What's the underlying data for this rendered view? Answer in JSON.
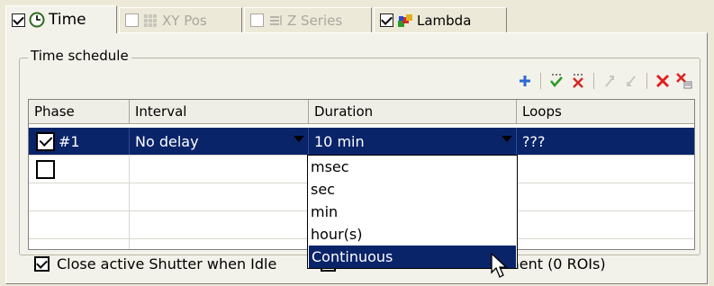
{
  "tabs": [
    {
      "label": "Time",
      "checked": true,
      "active": true,
      "icon": "clock-icon"
    },
    {
      "label": "XY Pos",
      "checked": false,
      "disabled": true,
      "icon": "grid-icon"
    },
    {
      "label": "Z Series",
      "checked": false,
      "disabled": true,
      "icon": "z-stack-icon"
    },
    {
      "label": "Lambda",
      "checked": true,
      "icon": "lambda-colors-icon"
    }
  ],
  "group_title": "Time schedule",
  "toolbar": [
    "add-icon",
    "check-all-icon",
    "uncheck-all-icon",
    "move-up-icon",
    "move-down-icon",
    "delete-icon",
    "delete-all-icon"
  ],
  "grid": {
    "columns": [
      "Phase",
      "Interval",
      "Duration",
      "Loops"
    ],
    "rows": [
      {
        "checked": true,
        "phase": "#1",
        "interval": "No delay",
        "duration": "10 min",
        "loops": "???"
      },
      {
        "checked": false,
        "phase": "",
        "interval": "",
        "duration": "",
        "loops": ""
      }
    ]
  },
  "duration_dropdown": {
    "options": [
      "msec",
      "sec",
      "min",
      "hour(s)",
      "Continuous"
    ],
    "highlighted": "Continuous"
  },
  "bottom": {
    "close_shutter_label": "Close active Shutter when Idle",
    "close_shutter_checked": true,
    "measurement_label": "Perform Time Measurement (0 ROIs)"
  },
  "colors": {
    "selection": "#0a246a",
    "panel": "#f3f2ea"
  }
}
